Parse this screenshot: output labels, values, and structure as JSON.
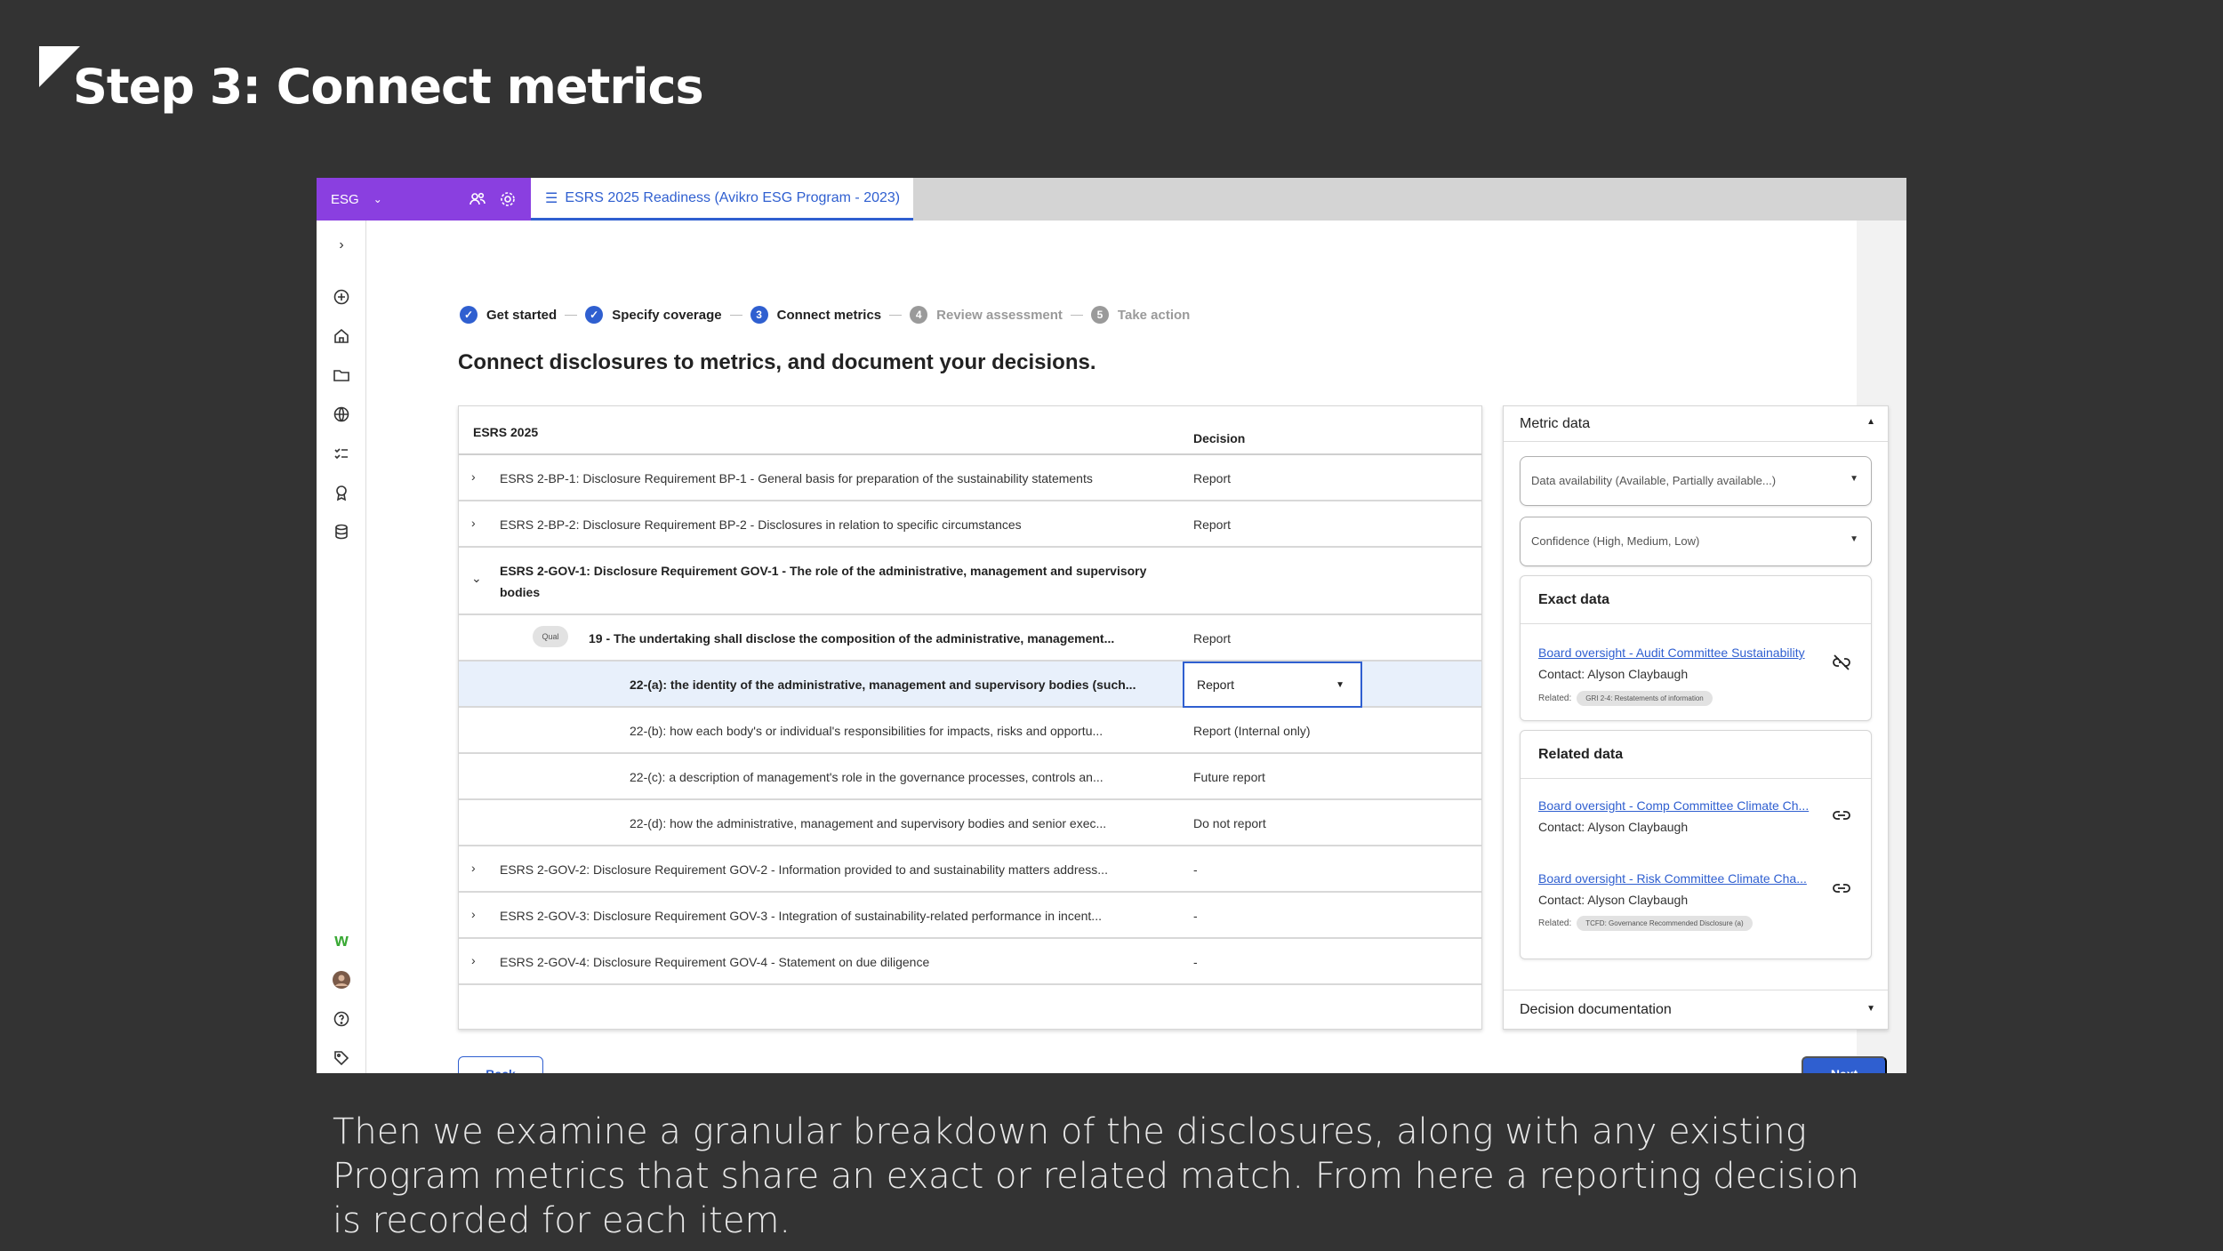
{
  "slide": {
    "title": "Step 3: Connect metrics",
    "caption": "Then we examine a granular breakdown of the disclosures, along with any existing Program metrics that share an exact or related match. From here a reporting decision is recorded for each item."
  },
  "app": {
    "brand": "ESG",
    "tab_label": "ESRS 2025 Readiness (Avikro ESG Program - 2023)",
    "colors": {
      "brand": "#8a3fe0",
      "accent": "#2f5fd0"
    }
  },
  "stepper": [
    {
      "label": "Get started",
      "state": "done"
    },
    {
      "label": "Specify coverage",
      "state": "done"
    },
    {
      "num": "3",
      "label": "Connect metrics",
      "state": "current"
    },
    {
      "num": "4",
      "label": "Review assessment",
      "state": "todo"
    },
    {
      "num": "5",
      "label": "Take action",
      "state": "todo"
    }
  ],
  "heading": "Connect disclosures to metrics, and document your decisions.",
  "table": {
    "col1": "ESRS 2025",
    "col2": "Decision",
    "rows": [
      {
        "text": "ESRS 2-BP-1: Disclosure Requirement BP-1 - General basis for preparation of the sustainability statements",
        "decision": "Report"
      },
      {
        "text": "ESRS 2-BP-2: Disclosure Requirement BP-2 - Disclosures in relation to specific circumstances",
        "decision": "Report"
      },
      {
        "text": "ESRS 2-GOV-1: Disclosure Requirement GOV-1 - The role of the administrative, management and supervisory",
        "text2": "bodies",
        "decision": ""
      },
      {
        "badge": "Qual",
        "text": "19 - The undertaking shall disclose the composition of the administrative, management...",
        "decision": "Report"
      },
      {
        "text": "22-(a): the identity of the administrative, management and supervisory bodies (such...",
        "decision": "Report"
      },
      {
        "text": "22-(b): how each body's or individual's responsibilities for impacts, risks and opportu...",
        "decision": "Report (Internal only)"
      },
      {
        "text": "22-(c): a description of management's role in the governance processes, controls an...",
        "decision": "Future report"
      },
      {
        "text": "22-(d): how the administrative, management and supervisory bodies and senior exec...",
        "decision": "Do not report"
      },
      {
        "text": "ESRS 2-GOV-2: Disclosure Requirement GOV-2 - Information provided to and sustainability matters address...",
        "decision": "-"
      },
      {
        "text": "ESRS 2-GOV-3: Disclosure Requirement GOV-3 - Integration of sustainability-related performance in incent...",
        "decision": "-"
      },
      {
        "text": "ESRS 2-GOV-4: Disclosure Requirement GOV-4 - Statement on due diligence",
        "decision": "-"
      }
    ]
  },
  "panel": {
    "title": "Metric data",
    "availability_placeholder": "Data availability (Available, Partially available...)",
    "confidence_placeholder": "Confidence (High, Medium, Low)",
    "exact": {
      "title": "Exact data",
      "link": "Board oversight - Audit Committee Sustainability",
      "contact": "Contact: Alyson Claybaugh",
      "related_label": "Related:",
      "related_chip": "GRI 2-4: Restatements of information"
    },
    "related": {
      "title": "Related data",
      "items": [
        {
          "link": "Board oversight - Comp Committee Climate Ch...",
          "contact": "Contact: Alyson Claybaugh"
        },
        {
          "link": "Board oversight - Risk Committee Climate Cha...",
          "contact": "Contact: Alyson Claybaugh",
          "related_label": "Related:",
          "related_chip": "TCFD: Governance Recommended Disclosure (a)"
        }
      ]
    },
    "footer": "Decision documentation"
  },
  "buttons": {
    "back": "Back",
    "next": "Next"
  }
}
